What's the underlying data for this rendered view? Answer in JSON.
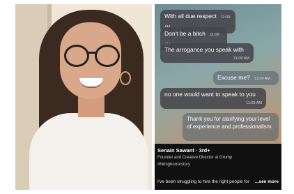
{
  "messages": [
    {
      "text": "With all due respect",
      "time": "11:09 AM",
      "dir": "in"
    },
    {
      "text": "Don't be a bitch",
      "time": "11:09 AM",
      "dir": "in"
    },
    {
      "text": "The arrogance you speak with",
      "time": "11:09 AM",
      "dir": "in"
    },
    {
      "text": "Excuse me?",
      "time": "11:09 AM",
      "dir": "out"
    },
    {
      "text": "no one would want to speak to you",
      "time": "11:09 AM",
      "dir": "in"
    },
    {
      "text": "Thank you for clarifying your level of experience and professionalism.",
      "time": "",
      "dir": "out"
    }
  ],
  "profile": {
    "name": "Senain Sawant · 3rd+",
    "role": "Founder and Creative Director at Grump",
    "hashtag": "#hiringhorrorstory",
    "post_preview": "I've been struggling to hire the right people for",
    "see_more": "...see more"
  },
  "colors": {
    "chat_bubble_in": "#46464b",
    "profile_bg": "#101010"
  }
}
